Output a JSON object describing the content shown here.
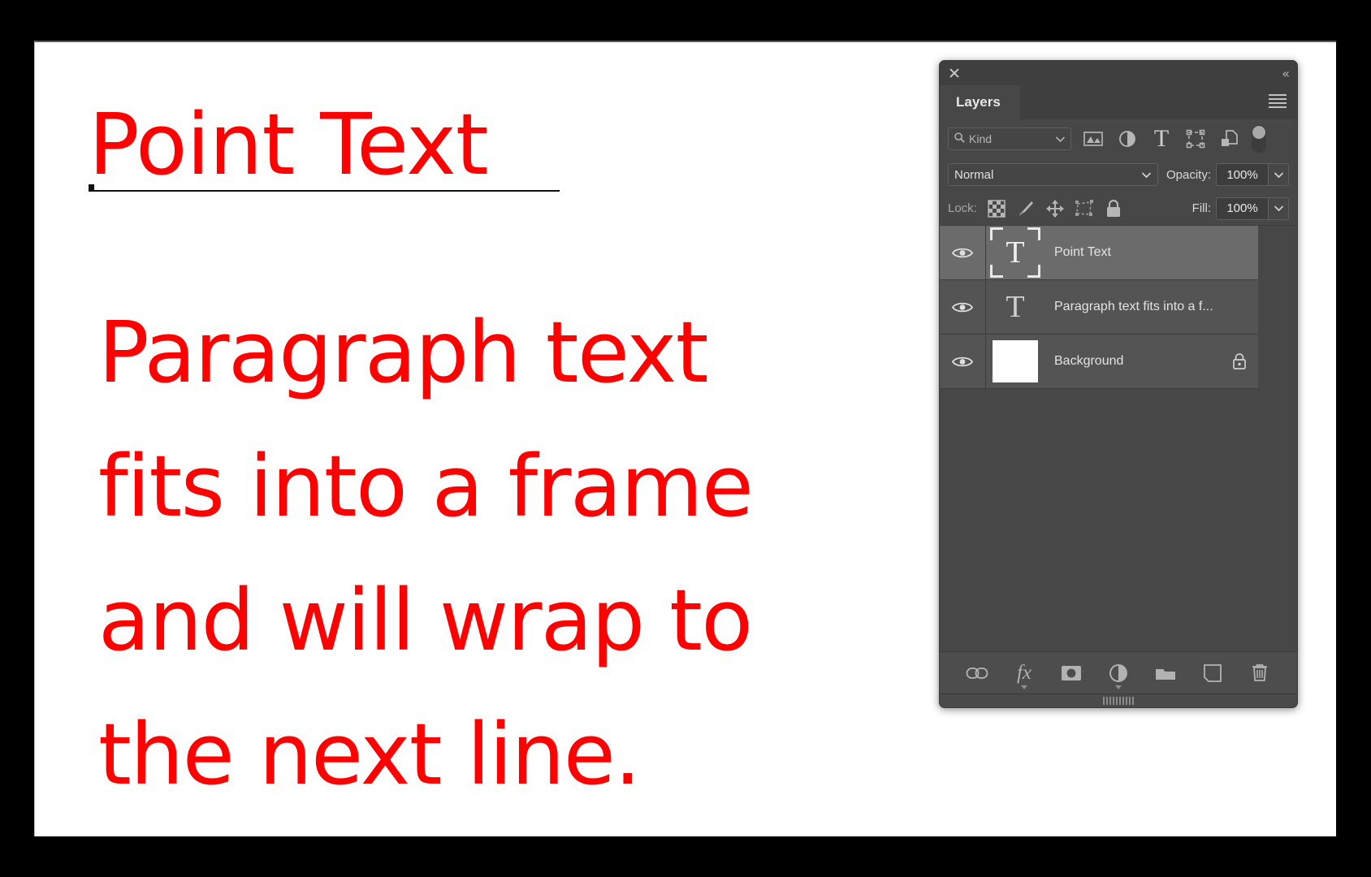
{
  "canvas": {
    "point_text": "Point Text",
    "paragraph_text": "Paragraph text fits into a frame and will wrap to the next line.",
    "text_color": "#ff0000",
    "background_color": "#ffffff"
  },
  "panel": {
    "title": "Layers",
    "close_icon": "close-icon",
    "collapse_icon": "collapse-panel-icon",
    "menu_icon": "panel-menu-icon",
    "filter": {
      "kind_label": "Kind",
      "search_icon": "search-icon",
      "chevron_icon": "chevron-down-icon",
      "icons": [
        {
          "name": "filter-pixel-layers-icon",
          "title": "Pixel layers"
        },
        {
          "name": "filter-adjustment-layers-icon",
          "title": "Adjustment layers"
        },
        {
          "name": "filter-type-layers-icon",
          "title": "Type layers"
        },
        {
          "name": "filter-shape-layers-icon",
          "title": "Shape layers"
        },
        {
          "name": "filter-smart-objects-icon",
          "title": "Smart objects"
        }
      ],
      "toggle_name": "filter-enable-toggle"
    },
    "blend": {
      "mode": "Normal",
      "opacity_label": "Opacity:",
      "opacity_value": "100%"
    },
    "lock": {
      "label": "Lock:",
      "fill_label": "Fill:",
      "fill_value": "100%",
      "icons": [
        {
          "name": "lock-transparent-pixels-icon"
        },
        {
          "name": "lock-image-pixels-icon"
        },
        {
          "name": "lock-position-icon"
        },
        {
          "name": "lock-artboard-nesting-icon"
        },
        {
          "name": "lock-all-icon"
        }
      ]
    },
    "layers": [
      {
        "name": "Point Text",
        "kind": "type",
        "selected": true,
        "visible": true,
        "locked": false,
        "thumb": "type-framed"
      },
      {
        "name": "Paragraph text fits into a f...",
        "kind": "type",
        "selected": false,
        "visible": true,
        "locked": false,
        "thumb": "type"
      },
      {
        "name": "Background",
        "kind": "pixel",
        "selected": false,
        "visible": true,
        "locked": true,
        "thumb": "white"
      }
    ],
    "footer_buttons": [
      {
        "name": "link-layers-button",
        "icon": "link-icon"
      },
      {
        "name": "layer-style-button",
        "icon": "fx-icon",
        "label": "fx",
        "caret": true
      },
      {
        "name": "layer-mask-button",
        "icon": "mask-icon"
      },
      {
        "name": "new-fill-adjustment-layer-button",
        "icon": "half-circle-icon",
        "caret": true
      },
      {
        "name": "new-group-button",
        "icon": "folder-icon"
      },
      {
        "name": "new-layer-button",
        "icon": "new-layer-icon"
      },
      {
        "name": "delete-layer-button",
        "icon": "trash-icon"
      }
    ],
    "colors": {
      "panel_bg": "#474747",
      "titlebar_bg": "#3f3f3f",
      "row_bg": "#545454",
      "row_selected_bg": "#6b6b6b",
      "footer_bg": "#4d4d4d",
      "text": "#e3e3e3"
    }
  }
}
